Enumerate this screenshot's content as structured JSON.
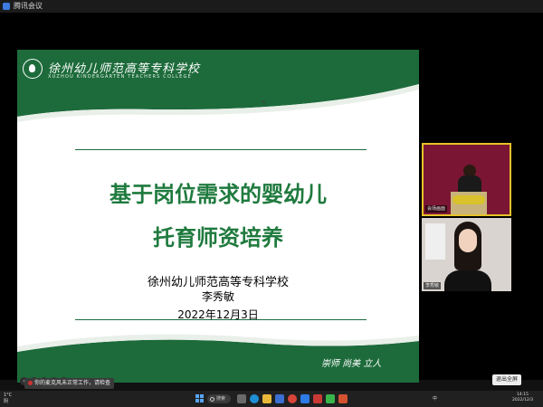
{
  "window": {
    "title": "腾讯会议"
  },
  "slide": {
    "college_name_cn": "徐州幼儿师范高等专科学校",
    "college_name_en": "XUZHOU KINDERGARTEN TEACHERS COLLEGE",
    "title_line1": "基于岗位需求的婴幼儿",
    "title_line2": "托育师资培养",
    "school": "徐州幼儿师范高等专科学校",
    "author": "李秀敏",
    "date": "2022年12月3日",
    "motto": "崇师  尚美  立人",
    "colors": {
      "brand_green": "#1f7a3e",
      "band_green": "#1d6b3b"
    }
  },
  "videos": [
    {
      "label": "会场画面"
    },
    {
      "label": "李秀敏"
    }
  ],
  "notification": {
    "text": "你的麦克风未正常工作，请检查"
  },
  "fullscreen_button": {
    "label": "退出全屏"
  },
  "taskbar": {
    "weather_temp": "1°C",
    "weather_desc": "阴",
    "search_label": "搜索",
    "tray_text": "中",
    "time": "14:15",
    "date": "2022/12/3"
  }
}
